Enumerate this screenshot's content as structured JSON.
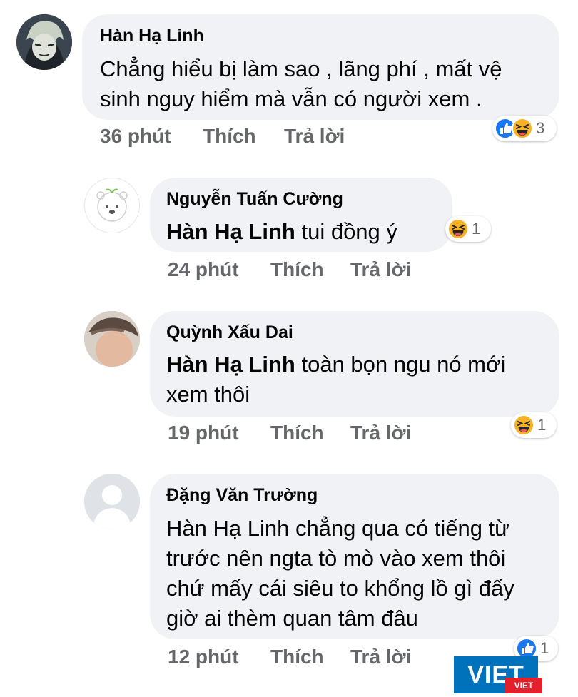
{
  "comments": [
    {
      "author": "Hàn Hạ Linh",
      "mention": "",
      "lines": [
        "Chẳng hiểu bị làm sao , lãng phí , mất vệ",
        "sinh nguy hiểm mà vẫn có người xem ."
      ],
      "time": "36 phút",
      "like": "Thích",
      "reply": "Trả lời",
      "reaction_icons": [
        "like-icon",
        "haha-icon"
      ],
      "reaction_count": "3"
    },
    {
      "author": "Nguyễn Tuấn Cường",
      "mention": "Hàn Hạ Linh",
      "lines": [
        "tui đồng ý"
      ],
      "time": "24 phút",
      "like": "Thích",
      "reply": "Trả lời",
      "reaction_icons": [
        "haha-icon"
      ],
      "reaction_count": "1"
    },
    {
      "author": "Quỳnh Xấu Dai",
      "mention": "Hàn Hạ Linh",
      "lines": [
        "toàn bọn ngu nó mới",
        "xem thôi"
      ],
      "time": "19 phút",
      "like": "Thích",
      "reply": "Trả lời",
      "reaction_icons": [
        "haha-icon"
      ],
      "reaction_count": "1"
    },
    {
      "author": "Đặng Văn Trường",
      "mention": "",
      "lines": [
        "Hàn Hạ Linh chẳng qua có tiếng từ",
        "trước nên ngta tò mò vào xem thôi",
        "chứ mấy cái siêu to khổng lồ gì đấy",
        "giờ ai thèm quan tâm đâu"
      ],
      "time": "12 phút",
      "like": "Thích",
      "reply": "Trả lời",
      "reaction_icons": [
        "like-icon"
      ],
      "reaction_count": "1"
    }
  ],
  "watermark": {
    "main": "VIET",
    "sub": "VIET"
  },
  "colors": {
    "bubble": "#f0f2f5",
    "meta_text": "#65676b",
    "like_blue": "#1877f2",
    "haha_yellow": "#f7b125",
    "watermark_blue": "#0072bc",
    "watermark_red": "#e4202c"
  }
}
